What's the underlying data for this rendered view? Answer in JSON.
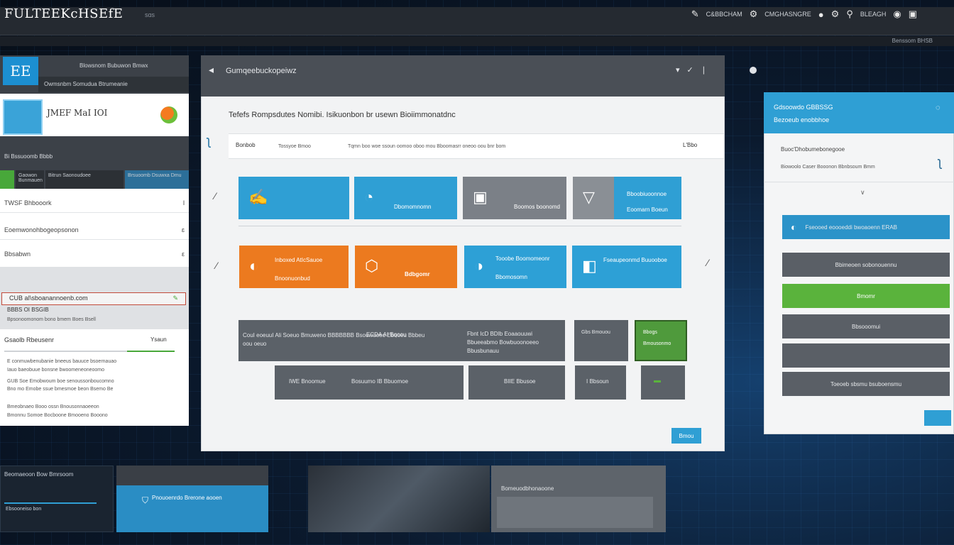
{
  "app": {
    "brand": "FULTEEKcHSEfE",
    "brand_sub": "sɑs",
    "topbar": [
      "C&BBCHAM",
      "CMGHASNGRE",
      "BLEAGH"
    ],
    "subbar": "Benssom BHSB"
  },
  "left_panel": {
    "logo": "EE",
    "top_line": "Blowsnom Bubuwon Bmwx",
    "nav": "Owmsnbm Somudua Btrumeanie",
    "card_title": "JMEF MaI IOI",
    "label": "Bi Bssuoomb Bbbb",
    "chips": [
      "Gaowon Bunmauen",
      "Bitrun Saonoudoee",
      "Brsuoomb Dsuwxa Dmu"
    ],
    "list": [
      {
        "text": "TWSF Bhbooork",
        "mark": "l"
      },
      {
        "text": "Eoemwonohbogeopsonon",
        "mark": "ɛ"
      },
      {
        "text": "Bbsabwn",
        "mark": "ε"
      }
    ],
    "red_row": "CUB aI\\sboanannoenb.com",
    "red_sub": "BBBS OI BSGIB",
    "red_sub2": "Bpsonoomonom bono bmem Boes Bsell",
    "section": "Gsaolb Rbeusenr",
    "section_r": "Ysaun",
    "text_lines": [
      "E conmuwbenubanie bneeus bauuce bsoernauao",
      "Iauo baeobuue bonsne bwoomeneoneoomo",
      "GUB Soe Emobwoum boe senoussonboucomno",
      "Bno mo Emobe ssue bmesmoe beon Bsemo Be",
      "Bmeobnaeo Booo ossn Bnousonnaoeeon",
      "Bmonnu Somoe Bocboone Bmooeno Booono"
    ]
  },
  "center_dialog": {
    "title": "Gumqeebuckopeiwz",
    "heading": "Tefefs Rompsdutes Nomibi. Isikuonbon br usewn Bioiimmonatdnc",
    "search_label": "Bonbob",
    "search_placeholder": "Tossyoe Bmoo",
    "search_mid": "Tqmn boo woe ssoun oomoo oboo mou Bboomasrr oneoo oou bnr bom",
    "search_right": "L'Bbo",
    "tiles_row1": [
      {
        "label": "",
        "icon": "✍",
        "color": "#2f9fd4"
      },
      {
        "label": "Dbomomnomn",
        "icon": "◔",
        "color": "#2f9fd4"
      },
      {
        "label": "Boomos boonomd",
        "icon": "▣",
        "color": "#7b8087"
      },
      {
        "label": "Bboobiuoonnoe Eoomarn Boeun",
        "icon": "▽",
        "color": "#8a8f95"
      }
    ],
    "tiles_row2": [
      {
        "label": "Inboxed AtIcSauoe Bnoonuonbud",
        "icon": "◐",
        "color": "#ec7a1f"
      },
      {
        "label": "Bdbgomr",
        "icon": "⬡",
        "color": "#ec7a1f"
      },
      {
        "label": "Tooobe Boomomeonr Bbomosomn",
        "icon": "◑",
        "color": "#2da0d6"
      },
      {
        "label": "Fseaupeonmd Buuooboe",
        "icon": "◧",
        "color": "#2da0d6"
      }
    ],
    "bars_row1": [
      {
        "label": "CouI eoeuuI Ali Soeuo Bmuweno BBBBBBB Bsouwuoeo Ebooeu Bbbeu oou oeuo",
        "color": "#5b6168"
      },
      {
        "label": "Gbs Bmouou",
        "color": "#5b6168"
      },
      {
        "label": "Bbogs Bmousonmo",
        "color": "#4f9a3c"
      }
    ],
    "bars_row1_mid": "ECDA AI Bqoou",
    "bars_row1_right": "Fbnt IcD BDIb Eoaaouuwi Bbueeabmo Bowbuoonoeeo Bbusbunauu",
    "bars_row2": [
      {
        "label": "IWE Bnoomue"
      },
      {
        "label": "Bosuumo   IB Bbuomoe"
      },
      {
        "label": "BIIE Bbusoe"
      },
      {
        "label": "I Bbsoun"
      },
      {
        "label": ""
      }
    ],
    "ok_label": "Bmou"
  },
  "right_panel": {
    "h1": "Gdsoowdo GBBSSG",
    "h2": "Bezoeub enobbhoe",
    "t1": "Buoc'Dhobumebonegooe",
    "t2": "Biowoolo Caser Booonon Bbnbsoum Bmm",
    "buttons": [
      {
        "label": "Fseooed eoooeddi bwoaoenn ERAB",
        "kind": "blue"
      },
      {
        "label": "Bbimeoen sobonouennu",
        "kind": "grey"
      },
      {
        "label": "Bmomr",
        "kind": "green"
      },
      {
        "label": "Bbsooomui",
        "kind": "grey"
      },
      {
        "label": "",
        "kind": "grey"
      },
      {
        "label": "Toeoeb sbsmu bsuboensmu",
        "kind": "grey"
      }
    ]
  },
  "bottom_strip": {
    "panel1": "Beomaeoon Bow Bmrsoom",
    "panel1_sub": "Ebsooneiso bon",
    "panel2": "Pnouoenrdo Brerone aooen",
    "panel4": "Bomeuodbhonaoone"
  },
  "colors": {
    "accent_blue": "#2f9fd4",
    "accent_orange": "#ec7a1f",
    "accent_green": "#5ab33c",
    "panel_dark": "#3c4148"
  }
}
